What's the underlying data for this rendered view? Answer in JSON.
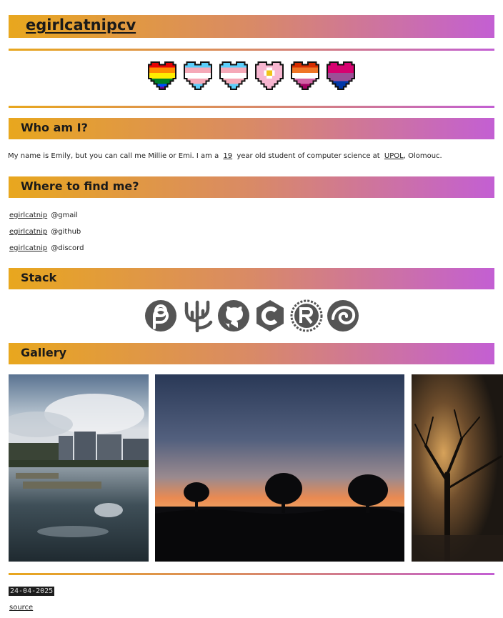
{
  "header": {
    "name_link": "egirlcatnip",
    "cv_link": "cv"
  },
  "flags": [
    {
      "icon": "rainbow-pride-heart-icon"
    },
    {
      "icon": "trans-pride-heart-icon"
    },
    {
      "icon": "trans-pride-heart-icon"
    },
    {
      "icon": "flower-heart-icon"
    },
    {
      "icon": "lesbian-pride-heart-icon"
    },
    {
      "icon": "bi-pride-heart-icon"
    }
  ],
  "about": {
    "heading": "Who am I?",
    "text_before_age": "My name is Emily, but you can call me Millie or Emi. I am a",
    "age": "19",
    "text_before_school": "year old student of computer science at",
    "school": "UPOL",
    "text_after_school": ", Olomouc."
  },
  "contacts": {
    "heading": "Where to find me?",
    "items": [
      {
        "handle": "egirlcatnip",
        "service": "@gmail"
      },
      {
        "handle": "egirlcatnip",
        "service": "@github"
      },
      {
        "handle": "egirlcatnip",
        "service": "@discord"
      }
    ]
  },
  "stack": {
    "heading": "Stack",
    "items": [
      {
        "icon": "fedora-icon"
      },
      {
        "icon": "fish-shell-icon"
      },
      {
        "icon": "github-icon"
      },
      {
        "icon": "c-language-icon"
      },
      {
        "icon": "rust-icon"
      },
      {
        "icon": "nix-icon"
      }
    ]
  },
  "gallery": {
    "heading": "Gallery",
    "photos": [
      {
        "subject": "river-city-photo"
      },
      {
        "subject": "sunset-trees-photo"
      },
      {
        "subject": "foggy-tree-night-photo"
      }
    ]
  },
  "footer": {
    "date": "24-04-2025",
    "source_link": "source"
  },
  "colors": {
    "gradient_start": "#e8a71e",
    "gradient_mid": "#d98a66",
    "gradient_end": "#c35fd3"
  }
}
